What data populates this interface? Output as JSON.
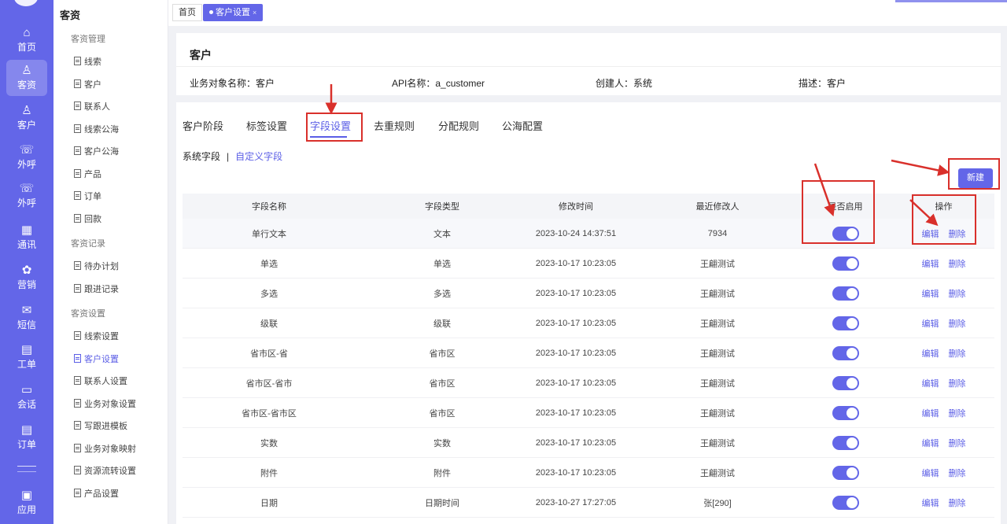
{
  "rail": {
    "items": [
      {
        "label": "首页",
        "icon": "home-icon",
        "glyph": "⌂"
      },
      {
        "label": "客资",
        "icon": "users-icon",
        "glyph": "♙"
      },
      {
        "label": "客户",
        "icon": "user-icon",
        "glyph": "♙"
      },
      {
        "label": "外呼",
        "icon": "phone-out-icon",
        "glyph": "☏"
      },
      {
        "label": "外呼",
        "icon": "phone-out-icon",
        "glyph": "☏"
      },
      {
        "label": "通讯",
        "icon": "contacts-icon",
        "glyph": "▦"
      },
      {
        "label": "营销",
        "icon": "marketing-icon",
        "glyph": "✿"
      },
      {
        "label": "短信",
        "icon": "message-icon",
        "glyph": "✉"
      },
      {
        "label": "工单",
        "icon": "clipboard-icon",
        "glyph": "▤"
      },
      {
        "label": "会话",
        "icon": "chat-icon",
        "glyph": "▭"
      },
      {
        "label": "订单",
        "icon": "order-icon",
        "glyph": "▤"
      },
      {
        "label": "应用",
        "icon": "apps-icon",
        "glyph": "▣"
      }
    ]
  },
  "sidebar": {
    "title": "客资",
    "groups": [
      {
        "label": "客资管理",
        "items": [
          "线索",
          "客户",
          "联系人",
          "线索公海",
          "客户公海",
          "产品",
          "订单",
          "回款"
        ]
      },
      {
        "label": "客资记录",
        "items": [
          "待办计划",
          "跟进记录"
        ]
      },
      {
        "label": "客资设置",
        "items": [
          "线索设置",
          "客户设置",
          "联系人设置",
          "业务对象设置",
          "写跟进模板",
          "业务对象映射",
          "资源流转设置",
          "产品设置"
        ]
      }
    ]
  },
  "tabbar": {
    "home": "首页",
    "current": "客户设置",
    "close": "×"
  },
  "header": {
    "title": "客户",
    "meta": [
      "业务对象名称：客户",
      "API名称：a_customer",
      "创建人：系统",
      "描述：客户"
    ]
  },
  "tabs": [
    "客户阶段",
    "标签设置",
    "字段设置",
    "去重规则",
    "分配规则",
    "公海配置"
  ],
  "subtabs": {
    "system": "系统字段",
    "divider": "|",
    "custom": "自定义字段"
  },
  "new_button": "新建",
  "table": {
    "columns": [
      "字段名称",
      "字段类型",
      "修改时间",
      "最近修改人",
      "是否启用",
      "操作"
    ],
    "rows": [
      {
        "name": "单行文本",
        "type": "文本",
        "time": "2023-10-24 14:37:51",
        "user": "7934",
        "enabled": true
      },
      {
        "name": "单选",
        "type": "单选",
        "time": "2023-10-17 10:23:05",
        "user": "王翩测试",
        "enabled": true
      },
      {
        "name": "多选",
        "type": "多选",
        "time": "2023-10-17 10:23:05",
        "user": "王翩测试",
        "enabled": true
      },
      {
        "name": "级联",
        "type": "级联",
        "time": "2023-10-17 10:23:05",
        "user": "王翩测试",
        "enabled": true
      },
      {
        "name": "省市区-省",
        "type": "省市区",
        "time": "2023-10-17 10:23:05",
        "user": "王翩测试",
        "enabled": true
      },
      {
        "name": "省市区-省市",
        "type": "省市区",
        "time": "2023-10-17 10:23:05",
        "user": "王翩测试",
        "enabled": true
      },
      {
        "name": "省市区-省市区",
        "type": "省市区",
        "time": "2023-10-17 10:23:05",
        "user": "王翩测试",
        "enabled": true
      },
      {
        "name": "实数",
        "type": "实数",
        "time": "2023-10-17 10:23:05",
        "user": "王翩测试",
        "enabled": true
      },
      {
        "name": "附件",
        "type": "附件",
        "time": "2023-10-17 10:23:05",
        "user": "王翩测试",
        "enabled": true
      },
      {
        "name": "日期",
        "type": "日期时间",
        "time": "2023-10-27 17:27:05",
        "user": "张[290]",
        "enabled": true
      }
    ],
    "edit_label": "编辑",
    "delete_label": "删除"
  },
  "colors": {
    "accent": "#6366e8",
    "annotation": "#d9302b"
  }
}
